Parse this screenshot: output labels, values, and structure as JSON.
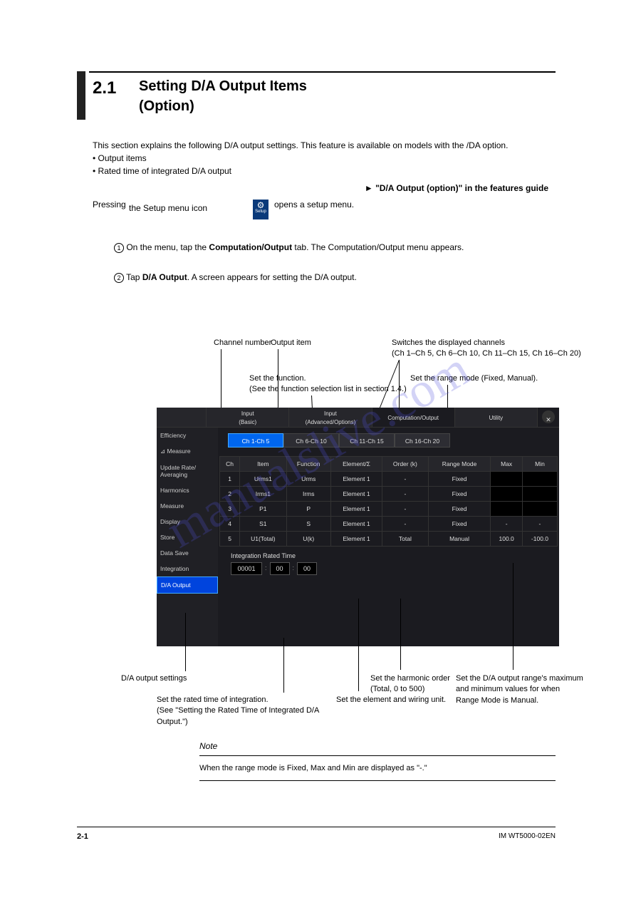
{
  "header": {
    "section_num": "2.1",
    "title_line1": "Setting D/A Output Items",
    "title_line2": "(Option)"
  },
  "intro": "This section explains the following D/A output settings. This feature is available on models with the /DA option.",
  "bullets": [
    "Output items",
    "Rated time of integrated D/A output"
  ],
  "features_title": "► \"D/A Output (option)\" in the features guide",
  "pressing_prefix": "Pressing",
  "pressing_suffix": "opens a setup menu.",
  "setup_icon_label": "Setup",
  "steps": {
    "s1_num": "1",
    "s1_text_a": "On the menu, tap the ",
    "s1_text_b": "Computation/Output",
    "s1_text_c": " tab. The Computation/Output menu appears.",
    "s2_num": "2",
    "s2_text_a": "Tap ",
    "s2_text_b": "D/A Output",
    "s2_text_c": ". A screen appears for setting the D/A output."
  },
  "annotations": {
    "ch_num": "Channel number",
    "output_item": "Output item",
    "switch1": "Switches the displayed channels",
    "switch2": "(Ch 1–Ch 5, Ch 6–Ch 10, Ch 11–Ch 15, Ch 16–Ch 20)",
    "range_mode1": "Set the function.",
    "range_mode2": "(See the function selection list",
    "range_mode3": "Set the range mode (Fixed, Manual).",
    "range_mode4": "in section 1.4.)"
  },
  "below": {
    "da": "D/A output settings",
    "time1": "Set the rated time of integration.",
    "time2": "(See \"Setting the Rated Time of Integrated D/A Output.\")",
    "element": "Set the element and wiring unit.",
    "order": "Set the harmonic order (Total, 0 to 500)",
    "range_max": "Set the D/A output range's maximum and minimum values for when Range Mode is Manual."
  },
  "screenshot": {
    "tabs": {
      "t1a": "Input",
      "t1b": "(Basic)",
      "t2a": "Input",
      "t2b": "(Advanced/Options)",
      "t3": "Computation/Output",
      "t4": "Utility"
    },
    "side": [
      "Efficiency",
      "⊿ Measure",
      "Update Rate/\nAveraging",
      "Harmonics",
      "Measure",
      "Display",
      "Store",
      "Data Save",
      "Integration",
      "D/A Output"
    ],
    "chtabs": [
      "Ch 1-Ch 5",
      "Ch 6-Ch 10",
      "Ch 11-Ch 15",
      "Ch 16-Ch 20"
    ],
    "thead": [
      "Ch",
      "Item",
      "Function",
      "Element/Σ",
      "Order (k)",
      "Range Mode",
      "Max",
      "Min"
    ],
    "rows": [
      [
        "1",
        "Urms1",
        "Urms",
        "Element 1",
        "-",
        "Fixed",
        "",
        ""
      ],
      [
        "2",
        "Irms1",
        "Irms",
        "Element 1",
        "-",
        "Fixed",
        "",
        ""
      ],
      [
        "3",
        "P1",
        "P",
        "Element 1",
        "-",
        "Fixed",
        "",
        ""
      ],
      [
        "4",
        "S1",
        "S",
        "Element 1",
        "-",
        "Fixed",
        "-",
        "-"
      ],
      [
        "5",
        "U1(Total)",
        "U(k)",
        "Element 1",
        "Total",
        "Manual",
        "100.0",
        "-100.0"
      ]
    ],
    "int_label": "Integration Rated Time",
    "int_boxes": [
      "00001",
      "00",
      "00"
    ]
  },
  "note": {
    "hdr": "Note",
    "body": "When the range mode is Fixed, Max and Min are displayed as \"-.\""
  },
  "footer": {
    "page": "2-1",
    "doc": "IM WT5000-02EN"
  },
  "watermark": "manualslive.com"
}
